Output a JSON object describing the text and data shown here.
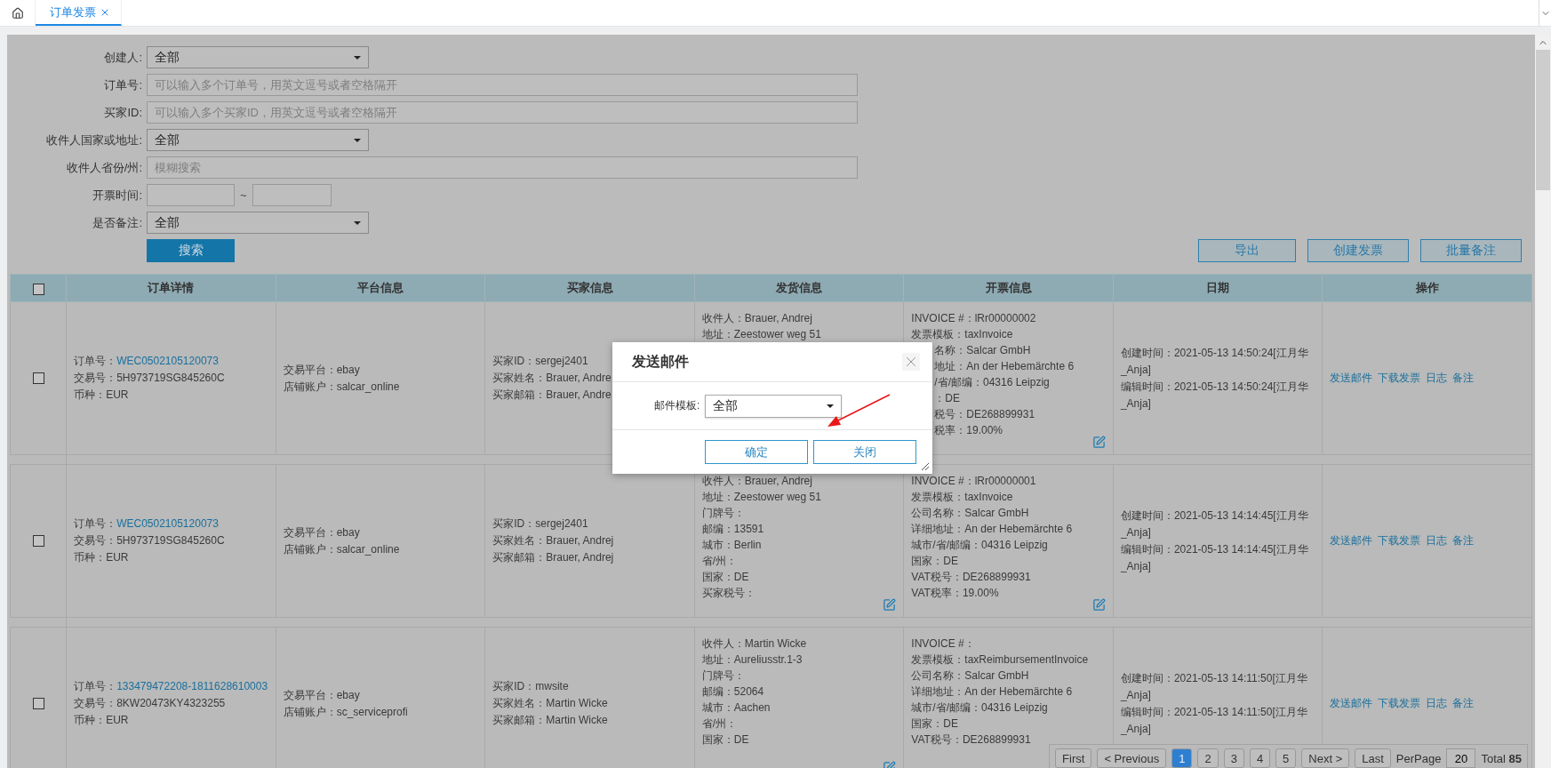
{
  "tabs": [
    {
      "kind": "home",
      "selected": false
    },
    {
      "kind": "page",
      "label": "订单发票",
      "selected": true
    }
  ],
  "filters": [
    {
      "kind": "select",
      "label": "创建人:",
      "value": "全部"
    },
    {
      "kind": "text",
      "label": "订单号:",
      "placeholder": "可以输入多个订单号，用英文逗号或者空格隔开"
    },
    {
      "kind": "text",
      "label": "买家ID:",
      "placeholder": "可以输入多个买家ID，用英文逗号或者空格隔开"
    },
    {
      "kind": "select",
      "label": "收件人国家或地址:",
      "value": "全部"
    },
    {
      "kind": "text",
      "label": "收件人省份/州:",
      "placeholder": "模糊搜索"
    },
    {
      "kind": "range",
      "label": "开票时间:",
      "separator": "~"
    },
    {
      "kind": "select",
      "label": "是否备注:",
      "value": "全部"
    }
  ],
  "search_button": "搜索",
  "actions": [
    "导出",
    "创建发票",
    "批量备注"
  ],
  "table": {
    "select_all": {
      "checked": false
    },
    "columns": [
      "订单详情",
      "平台信息",
      "买家信息",
      "发货信息",
      "开票信息",
      "日期",
      "操作"
    ],
    "rows": [
      {
        "checked": false,
        "order": [
          {
            "kind": "link",
            "label": "订单号：",
            "value": "WEC0502105120073"
          },
          {
            "kind": "text",
            "text": "交易号：5H973719SG845260C"
          },
          {
            "kind": "text",
            "text": "币种：EUR"
          }
        ],
        "platform": [
          "交易平台：ebay",
          "店铺账户：salcar_online"
        ],
        "buyer": [
          "买家ID：sergej2401",
          "买家姓名：Brauer, Andre",
          "买家邮箱：Brauer, Andre"
        ],
        "shipping": {
          "lines": [
            {
              "text": "收件人：Brauer, Andrej",
              "covered": false
            },
            {
              "text": "地址：Zeestower weg 51",
              "covered": false
            }
          ]
        },
        "invoice": {
          "lines": [
            {
              "text": "INVOICE #：lRr00000002",
              "covered": false
            },
            {
              "text": "发票模板：taxInvoice",
              "covered": false
            },
            {
              "text": "名称：Salcar GmbH",
              "covered": true
            },
            {
              "text": "地址：An der Hebemärchte 6",
              "covered": true
            },
            {
              "text": "/省/邮编：04316 Leipzig",
              "covered": true
            },
            {
              "text": "：DE",
              "covered": true
            },
            {
              "text": "税号：DE268899931",
              "covered": true
            },
            {
              "text": "税率：19.00%",
              "covered": true
            }
          ],
          "edit_icon": true
        },
        "dates": [
          [
            "创建时间：2021-05-13 14:50:24[江月华",
            "_Anja]"
          ],
          [
            "编辑时间：2021-05-13 14:50:24[江月华",
            "_Anja]"
          ]
        ],
        "ops": [
          "发送邮件",
          "下载发票",
          "日志",
          "备注"
        ]
      },
      {
        "checked": false,
        "order": [
          {
            "kind": "link",
            "label": "订单号：",
            "value": "WEC0502105120073"
          },
          {
            "kind": "text",
            "text": "交易号：5H973719SG845260C"
          },
          {
            "kind": "text",
            "text": "币种：EUR"
          }
        ],
        "platform": [
          "交易平台：ebay",
          "店铺账户：salcar_online"
        ],
        "buyer": [
          "买家ID：sergej2401",
          "买家姓名：Brauer, Andrej",
          "买家邮箱：Brauer, Andrej"
        ],
        "shipping": {
          "lines": [
            {
              "text": "收件人：Brauer, Andrej",
              "covered": false
            },
            {
              "text": "地址：Zeestower weg 51",
              "covered": false
            },
            {
              "text": "门牌号：",
              "covered": false
            },
            {
              "text": "邮编：13591",
              "covered": false
            },
            {
              "text": "城市：Berlin",
              "covered": false
            },
            {
              "text": "省/州：",
              "covered": false
            },
            {
              "text": "国家：DE",
              "covered": false
            },
            {
              "text": "买家税号：",
              "covered": false
            }
          ],
          "edit_icon": true
        },
        "invoice": {
          "lines": [
            {
              "text": "INVOICE #：lRr00000001",
              "covered": false
            },
            {
              "text": "发票模板：taxInvoice",
              "covered": false
            },
            {
              "text": "公司名称：Salcar GmbH",
              "covered": false
            },
            {
              "text": "详细地址：An der Hebemärchte 6",
              "covered": false
            },
            {
              "text": "城市/省/邮编：04316 Leipzig",
              "covered": false
            },
            {
              "text": "国家：DE",
              "covered": false
            },
            {
              "text": "VAT税号：DE268899931",
              "covered": false
            },
            {
              "text": "VAT税率：19.00%",
              "covered": false
            }
          ],
          "edit_icon": true
        },
        "dates": [
          [
            "创建时间：2021-05-13 14:14:45[江月华",
            "_Anja]"
          ],
          [
            "编辑时间：2021-05-13 14:14:45[江月华",
            "_Anja]"
          ]
        ],
        "ops": [
          "发送邮件",
          "下载发票",
          "日志",
          "备注"
        ]
      },
      {
        "checked": false,
        "order": [
          {
            "kind": "link",
            "label": "订单号：",
            "value": "133479472208-1811628610003"
          },
          {
            "kind": "text",
            "text": "交易号：8KW20473KY4323255"
          },
          {
            "kind": "text",
            "text": "币种：EUR"
          }
        ],
        "platform": [
          "交易平台：ebay",
          "店铺账户：sc_serviceprofi"
        ],
        "buyer": [
          "买家ID：mwsite",
          "买家姓名：Martin Wicke",
          "买家邮箱：Martin Wicke"
        ],
        "shipping": {
          "lines": [
            {
              "text": "收件人：Martin Wicke",
              "covered": false
            },
            {
              "text": "地址：Aureliusstr.1-3",
              "covered": false
            },
            {
              "text": "门牌号：",
              "covered": false
            },
            {
              "text": "邮编：52064",
              "covered": false
            },
            {
              "text": "城市：Aachen",
              "covered": false
            },
            {
              "text": "省/州：",
              "covered": false
            },
            {
              "text": "国家：DE",
              "covered": false
            }
          ],
          "edit_icon": true
        },
        "invoice": {
          "lines": [
            {
              "text": "INVOICE #：",
              "covered": false
            },
            {
              "text": "发票模板：taxReimbursementInvoice",
              "covered": false
            },
            {
              "text": "公司名称：Salcar GmbH",
              "covered": false
            },
            {
              "text": "详细地址：An der Hebemärchte 6",
              "covered": false
            },
            {
              "text": "城市/省/邮编：04316 Leipzig",
              "covered": false
            },
            {
              "text": "国家：DE",
              "covered": false
            },
            {
              "text": "VAT税号：DE268899931",
              "covered": false
            }
          ]
        },
        "dates": [
          [
            "创建时间：2021-05-13 14:11:50[江月华",
            "_Anja]"
          ],
          [
            "编辑时间：2021-05-13 14:11:50[江月华",
            "_Anja]"
          ]
        ],
        "ops": [
          "发送邮件",
          "下载发票",
          "日志",
          "备注"
        ]
      }
    ]
  },
  "pagination": {
    "first": "First",
    "previous": "< Previous",
    "pages": [
      {
        "label": "1",
        "selected": true
      },
      {
        "label": "2",
        "selected": false
      },
      {
        "label": "3",
        "selected": false
      },
      {
        "label": "4",
        "selected": false
      },
      {
        "label": "5",
        "selected": false
      }
    ],
    "next": "Next >",
    "last": "Last",
    "per_page_label": "PerPage",
    "per_page": "20",
    "total": "Total **85**"
  },
  "dialog": {
    "title": "发送邮件",
    "field_label": "邮件模板:",
    "field_value": "全部",
    "buttons": [
      "确定",
      "关闭"
    ]
  }
}
